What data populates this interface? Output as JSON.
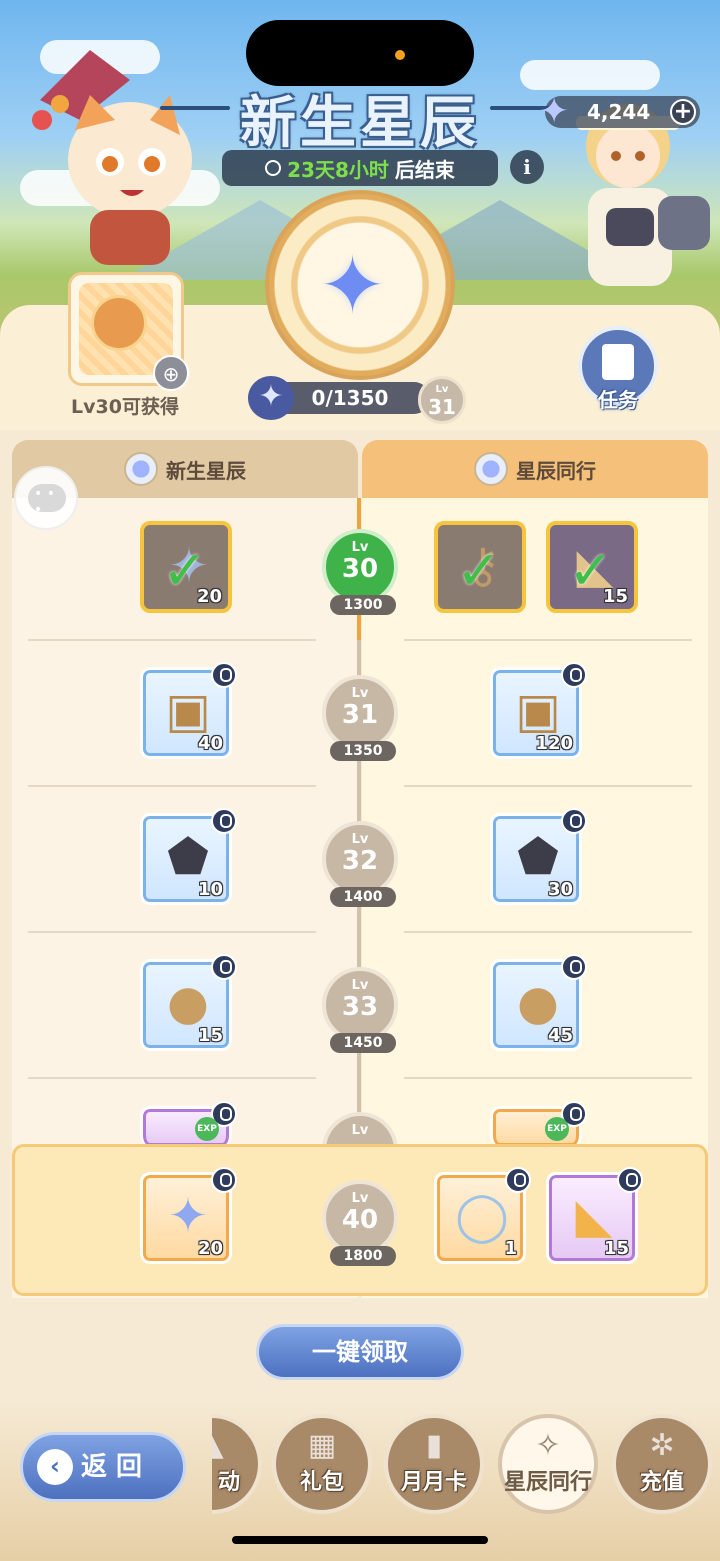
{
  "event": {
    "title": "新生星辰",
    "timer_days": "23天8小时",
    "timer_suffix": "后结束",
    "info_icon": "info-icon"
  },
  "currency": {
    "amount": "4,244",
    "icon": "star-gem-icon"
  },
  "preview": {
    "label": "Lv30可获得",
    "icon": "zoom-in-icon"
  },
  "progress": {
    "value": "0/1350",
    "current": 0,
    "max": 1350
  },
  "level_badge": {
    "prefix": "Lv",
    "level": "31"
  },
  "task_button": {
    "label": "任务"
  },
  "tabs": {
    "free": "新生星辰",
    "paid": "星辰同行"
  },
  "rows": [
    {
      "lv_prefix": "Lv",
      "level": "30",
      "points": "1300",
      "active": true,
      "free": [
        {
          "icon": "star-gem-icon",
          "qty": "20",
          "claimed": true
        }
      ],
      "paid": [
        {
          "icon": "key-icon",
          "qty": "",
          "claimed": true
        },
        {
          "icon": "cheese-icon",
          "qty": "15",
          "claimed": true
        }
      ]
    },
    {
      "lv_prefix": "Lv",
      "level": "31",
      "points": "1350",
      "free": [
        {
          "icon": "star-card-icon",
          "qty": "40"
        }
      ],
      "paid": [
        {
          "icon": "star-card-icon",
          "qty": "120"
        }
      ]
    },
    {
      "lv_prefix": "Lv",
      "level": "32",
      "points": "1400",
      "free": [
        {
          "icon": "ore-icon",
          "qty": "10"
        }
      ],
      "paid": [
        {
          "icon": "ore-icon",
          "qty": "30"
        }
      ]
    },
    {
      "lv_prefix": "Lv",
      "level": "33",
      "points": "1450",
      "free": [
        {
          "icon": "seed-bag-icon",
          "qty": "15"
        }
      ],
      "paid": [
        {
          "icon": "seed-bag-icon",
          "qty": "45"
        }
      ]
    },
    {
      "lv_prefix": "Lv",
      "level": "40",
      "points": "1800",
      "free": [
        {
          "icon": "star-gem-icon",
          "qty": "20"
        }
      ],
      "paid": [
        {
          "icon": "snowman-frame-icon",
          "qty": "1"
        },
        {
          "icon": "cheese-icon",
          "qty": "15"
        }
      ]
    }
  ],
  "partial_row": {
    "lv_prefix": "Lv",
    "badge": "EXP"
  },
  "claim_all": "一键领取",
  "back_button": "返 回",
  "nav": [
    {
      "label": "动",
      "icon": "bell-icon"
    },
    {
      "label": "礼包",
      "icon": "gift-icon"
    },
    {
      "label": "月月卡",
      "icon": "cat-card-icon"
    },
    {
      "label": "星辰同行",
      "icon": "compass-icon",
      "selected": true
    },
    {
      "label": "充值",
      "icon": "gem-icon"
    }
  ]
}
